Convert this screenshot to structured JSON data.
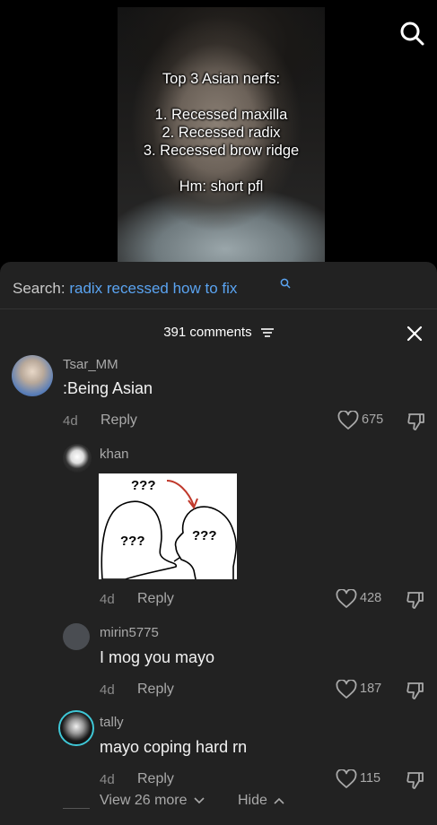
{
  "video": {
    "overlay_title": "Top 3 Asian nerfs:",
    "overlay_items": [
      "1. Recessed maxilla",
      "2. Recessed radix",
      "3. Recessed brow ridge"
    ],
    "overlay_footer": "Hm: short pfl"
  },
  "search": {
    "prefix": "Search:",
    "query": "radix recessed how to fix"
  },
  "comments_header": {
    "count_label": "391 comments"
  },
  "comments": [
    {
      "username": "Tsar_MM",
      "text": ":Being Asian",
      "age": "4d",
      "reply": "Reply",
      "likes": "675"
    }
  ],
  "replies": [
    {
      "username": "khan",
      "age": "4d",
      "reply": "Reply",
      "likes": "428",
      "image_text": {
        "top": "???",
        "left": "???",
        "right": "???"
      }
    },
    {
      "username": "mirin5775",
      "text": "I mog you mayo",
      "age": "4d",
      "reply": "Reply",
      "likes": "187"
    },
    {
      "username": "tally",
      "text": "mayo coping hard rn",
      "age": "4d",
      "reply": "Reply",
      "likes": "115"
    }
  ],
  "thread_controls": {
    "view_more": "View 26 more",
    "hide": "Hide"
  },
  "colors": {
    "sheet_bg": "#222222",
    "link_blue": "#5aa3f0"
  }
}
